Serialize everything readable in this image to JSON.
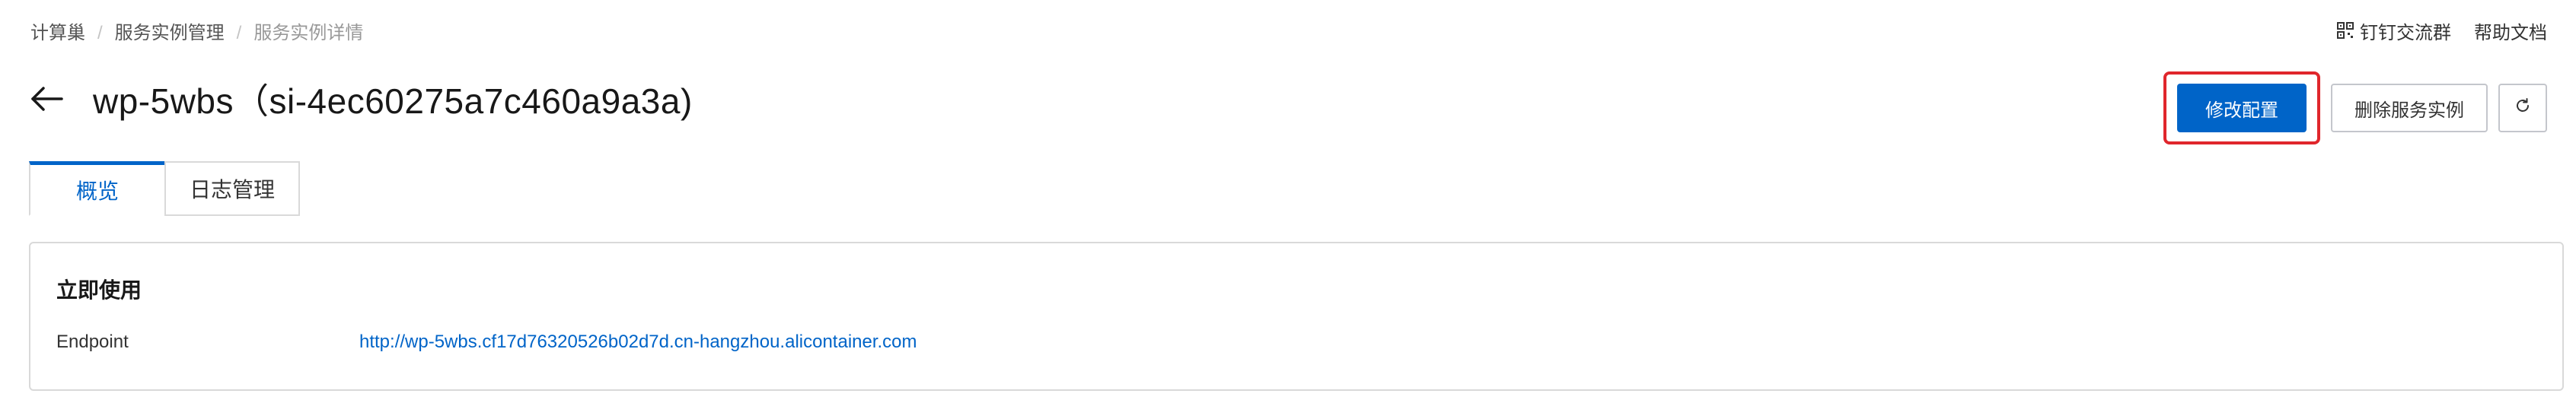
{
  "breadcrumb": [
    "计算巢",
    "服务实例管理",
    "服务实例详情"
  ],
  "top_links": {
    "dingtalk": "钉钉交流群",
    "help": "帮助文档"
  },
  "title": "wp-5wbs（si-4ec60275a7c460a9a3a)",
  "actions": {
    "modify": "修改配置",
    "delete": "删除服务实例"
  },
  "tabs": [
    "概览",
    "日志管理"
  ],
  "panel": {
    "title": "立即使用",
    "endpoint_label": "Endpoint",
    "endpoint_value": "http://wp-5wbs.cf17d76320526b02d7d.cn-hangzhou.alicontainer.com"
  },
  "colors": {
    "primary": "#0064c8",
    "highlight": "#e0262c",
    "border": "#d9d9d9"
  }
}
